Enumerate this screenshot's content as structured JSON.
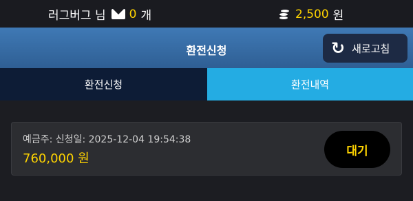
{
  "topbar": {
    "user_name": "러그버그 님",
    "message_count": "0",
    "message_unit": "개",
    "balance": "2,500",
    "balance_unit": "원"
  },
  "header": {
    "title": "환전신청",
    "refresh_label": "새로고침"
  },
  "tabs": [
    {
      "label": "환전신청",
      "active": false
    },
    {
      "label": "환전내역",
      "active": true
    }
  ],
  "records": [
    {
      "info": "예금주: 신청일: 2025-12-04 19:54:38",
      "amount": "760,000 원",
      "status": "대기"
    }
  ],
  "colors": {
    "accent": "#ffd400",
    "header": "#3f79b5",
    "active_tab": "#24ace3",
    "inactive_tab": "#0d1c36"
  },
  "icons": {
    "mail": "mail-icon",
    "coins": "coins-icon",
    "refresh": "refresh-icon"
  }
}
